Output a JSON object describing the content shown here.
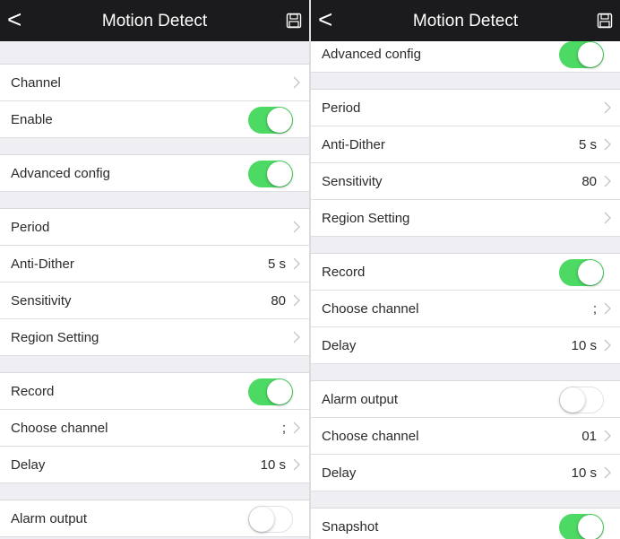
{
  "left": {
    "title": "Motion Detect",
    "back_glyph": "<",
    "rows": {
      "channel": "Channel",
      "enable": "Enable",
      "advanced": "Advanced config",
      "period": "Period",
      "anti_dither": "Anti-Dither",
      "anti_dither_value": "5 s",
      "sensitivity": "Sensitivity",
      "sensitivity_value": "80",
      "region": "Region Setting",
      "record": "Record",
      "choose_channel": "Choose channel",
      "choose_channel_value": ";",
      "delay": "Delay",
      "delay_value": "10 s",
      "alarm_output": "Alarm output"
    },
    "toggles": {
      "enable": true,
      "advanced": true,
      "record": true,
      "alarm_output": false
    }
  },
  "right": {
    "title": "Motion Detect",
    "back_glyph": "<",
    "rows": {
      "advanced_partial": "Advanced config",
      "period": "Period",
      "anti_dither": "Anti-Dither",
      "anti_dither_value": "5 s",
      "sensitivity": "Sensitivity",
      "sensitivity_value": "80",
      "region": "Region Setting",
      "record": "Record",
      "choose_channel": "Choose channel",
      "choose_channel_value": ";",
      "delay": "Delay",
      "delay_value": "10 s",
      "alarm_output": "Alarm output",
      "choose_channel_2": "Choose channel",
      "choose_channel_2_value": "01",
      "delay_2": "Delay",
      "delay_2_value": "10 s",
      "snapshot": "Snapshot"
    },
    "toggles": {
      "advanced": true,
      "record": true,
      "alarm_output": false,
      "snapshot": true
    }
  },
  "colors": {
    "nav_bg": "#1b1b1d",
    "switch_on": "#4cd964",
    "page_bg": "#efeff3"
  },
  "icons": {
    "back": "chevron-left-icon",
    "save": "save-icon",
    "row": "chevron-right-icon"
  }
}
